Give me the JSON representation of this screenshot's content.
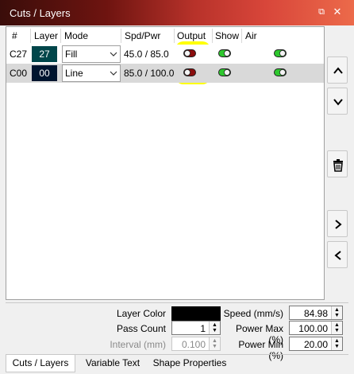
{
  "window": {
    "title": "Cuts / Layers"
  },
  "table": {
    "columns": [
      "#",
      "Layer",
      "Mode",
      "Spd/Pwr",
      "Output",
      "Show",
      "Air"
    ],
    "rows": [
      {
        "id": "C27",
        "layer": "27",
        "layer_color": "#00464a",
        "mode": "Fill",
        "spd_pwr": "45.0 / 85.0",
        "output": "off",
        "show": "on",
        "air": "on"
      },
      {
        "id": "C00",
        "layer": "00",
        "layer_color": "#00152f",
        "mode": "Line",
        "spd_pwr": "85.0 / 100.0",
        "output": "off",
        "show": "on",
        "air": "on"
      }
    ]
  },
  "side_buttons": [
    "move-up",
    "move-down",
    "delete",
    "expand-right",
    "collapse-left"
  ],
  "properties": {
    "layer_color_label": "Layer Color",
    "layer_color_value": "#000000",
    "pass_count_label": "Pass Count",
    "pass_count_value": "1",
    "interval_label": "Interval (mm)",
    "interval_value": "0.100",
    "speed_label": "Speed (mm/s)",
    "speed_value": "84.98",
    "power_max_label": "Power Max (%)",
    "power_max_value": "100.00",
    "power_min_label": "Power Min (%)",
    "power_min_value": "20.00"
  },
  "tabs": [
    {
      "label": "Cuts / Layers",
      "active": true
    },
    {
      "label": "Variable Text",
      "active": false
    },
    {
      "label": "Shape Properties",
      "active": false
    }
  ],
  "colors": {
    "toggle_on": "#2ec82e",
    "toggle_off": "#8b0d0d",
    "highlight": "#ffff00"
  }
}
